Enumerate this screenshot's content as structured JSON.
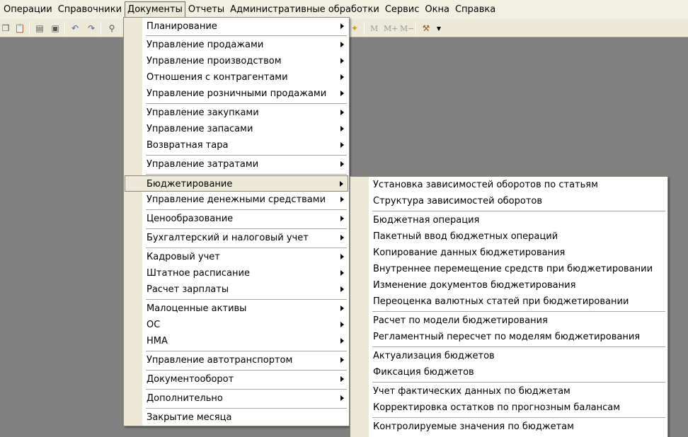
{
  "menubar": {
    "items": [
      {
        "label": "Операции"
      },
      {
        "label": "Справочники"
      },
      {
        "label": "Документы"
      },
      {
        "label": "Отчеты"
      },
      {
        "label": "Административные обработки"
      },
      {
        "label": "Сервис"
      },
      {
        "label": "Окна"
      },
      {
        "label": "Справка"
      }
    ]
  },
  "toolbar": {
    "m_label": "M",
    "mplus_label": "M+",
    "mminus_label": "M−"
  },
  "documents_menu": {
    "items": [
      {
        "label": "Планирование"
      },
      {
        "label": "Управление продажами"
      },
      {
        "label": "Управление производством"
      },
      {
        "label": "Отношения с контрагентами"
      },
      {
        "label": "Управление розничными продажами"
      },
      {
        "label": "Управление закупками"
      },
      {
        "label": "Управление запасами"
      },
      {
        "label": "Возвратная тара"
      },
      {
        "label": "Управление затратами"
      },
      {
        "label": "Бюджетирование"
      },
      {
        "label": "Управление денежными средствами"
      },
      {
        "label": "Ценообразование"
      },
      {
        "label": "Бухгалтерский и налоговый учет"
      },
      {
        "label": "Кадровый учет"
      },
      {
        "label": "Штатное расписание"
      },
      {
        "label": "Расчет зарплаты"
      },
      {
        "label": "Малоценные активы"
      },
      {
        "label": "ОС"
      },
      {
        "label": "НМА"
      },
      {
        "label": "Управление автотранспортом"
      },
      {
        "label": "Документооборот"
      },
      {
        "label": "Дополнительно"
      },
      {
        "label": "Закрытие месяца"
      }
    ],
    "highlighted": "Бюджетирование"
  },
  "budget_submenu": {
    "items": [
      {
        "label": "Установка зависимостей оборотов по статьям"
      },
      {
        "label": "Структура зависимостей оборотов"
      },
      {
        "label": "Бюджетная операция"
      },
      {
        "label": "Пакетный ввод бюджетных операций"
      },
      {
        "label": "Копирование данных бюджетирования"
      },
      {
        "label": "Внутреннее перемещение средств при бюджетировании"
      },
      {
        "label": "Изменение документов бюджетирования"
      },
      {
        "label": "Переоценка валютных статей при бюджетировании"
      },
      {
        "label": "Расчет по модели бюджетирования"
      },
      {
        "label": "Регламентный пересчет по моделям бюджетирования"
      },
      {
        "label": "Актуализация бюджетов"
      },
      {
        "label": "Фиксация бюджетов"
      },
      {
        "label": "Учет фактических данных по бюджетам"
      },
      {
        "label": "Корректировка остатков по прогнозным балансам"
      },
      {
        "label": "Контролируемые значения по бюджетам"
      }
    ]
  }
}
